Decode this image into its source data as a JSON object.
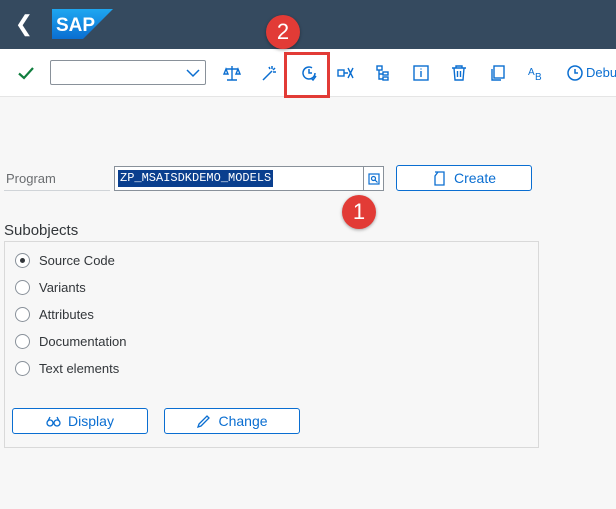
{
  "shell": {
    "back_icon": "chevron-left-icon",
    "logo_text": "SAP"
  },
  "toolbar": {
    "command_field": {
      "value": "",
      "placeholder": ""
    },
    "icons": [
      "check-icon",
      "chevron-down-icon",
      "checks-icon",
      "magic-wand-icon",
      "activate-icon",
      "where-used-icon",
      "hierarchy-icon",
      "info-icon",
      "delete-icon",
      "copy-icon",
      "rename-icon",
      "debug-icon"
    ],
    "debug_label": "Debu"
  },
  "program": {
    "label": "Program",
    "value": "ZP_MSAISDKDEMO_MODELS",
    "create_label": "Create"
  },
  "subobjects": {
    "title": "Subobjects",
    "options": [
      {
        "label": "Source Code",
        "selected": true
      },
      {
        "label": "Variants",
        "selected": false
      },
      {
        "label": "Attributes",
        "selected": false
      },
      {
        "label": "Documentation",
        "selected": false
      },
      {
        "label": "Text elements",
        "selected": false
      }
    ],
    "display_label": "Display",
    "change_label": "Change"
  },
  "callouts": {
    "first": "1",
    "second": "2"
  },
  "colors": {
    "shell": "#354a5f",
    "accent": "#0a6ed1",
    "callout": "#e23b36",
    "selection": "#0a3f8e"
  }
}
